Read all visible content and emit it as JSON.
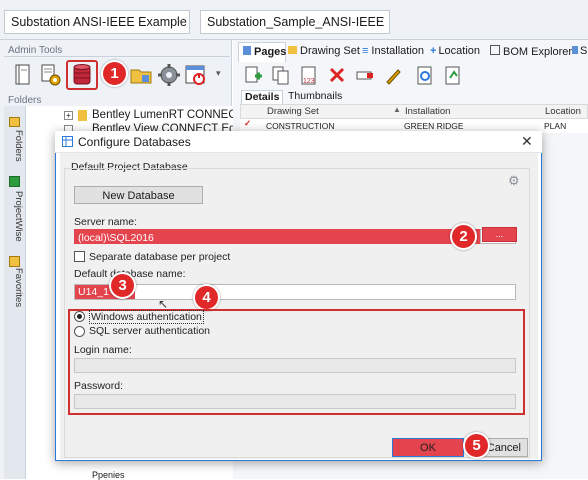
{
  "top": {
    "project_combo": "Substation ANSI-IEEE Example",
    "sample_combo": "Substation_Sample_ANSI-IEEE"
  },
  "left": {
    "admin_tools_label": "Admin Tools",
    "folders_label": "Folders",
    "vtabs": [
      "Folders",
      "ProjectWise",
      "Favorites"
    ],
    "tree_items": [
      "Bentley LumenRT CONNECT",
      "Bentley View CONNECT Edit",
      "Ppenies"
    ]
  },
  "right": {
    "tabs": [
      "Pages",
      "Drawing Set",
      "Installation",
      "Location",
      "BOM Explorer",
      "S"
    ],
    "subtabs": [
      "Details",
      "Thumbnails"
    ],
    "grid_headers": [
      "Drawing Set",
      "Installation",
      "Location"
    ],
    "grid_row": [
      "CONSTRUCTION",
      "GREEN RIDGE",
      "PLAN"
    ]
  },
  "dialog": {
    "title": "Configure Databases",
    "group_label": "Default Project Database",
    "new_database_label": "New Database",
    "server_name_label": "Server name:",
    "server_name_value": "(local)\\SQL2016",
    "browse_label": "...",
    "separate_db_label": "Separate database per project",
    "default_db_label": "Default database name:",
    "default_db_value": "U14_1",
    "windows_auth_label": "Windows authentication",
    "sql_auth_label": "SQL server authentication",
    "login_label": "Login name:",
    "password_label": "Password:",
    "ok_label": "OK",
    "cancel_label": "Cancel"
  },
  "annotations": [
    "1",
    "2",
    "3",
    "4",
    "5"
  ],
  "colors": {
    "highlight": "#e4444e",
    "annotation_red": "#e02828",
    "dialog_border": "#2b79d9"
  }
}
